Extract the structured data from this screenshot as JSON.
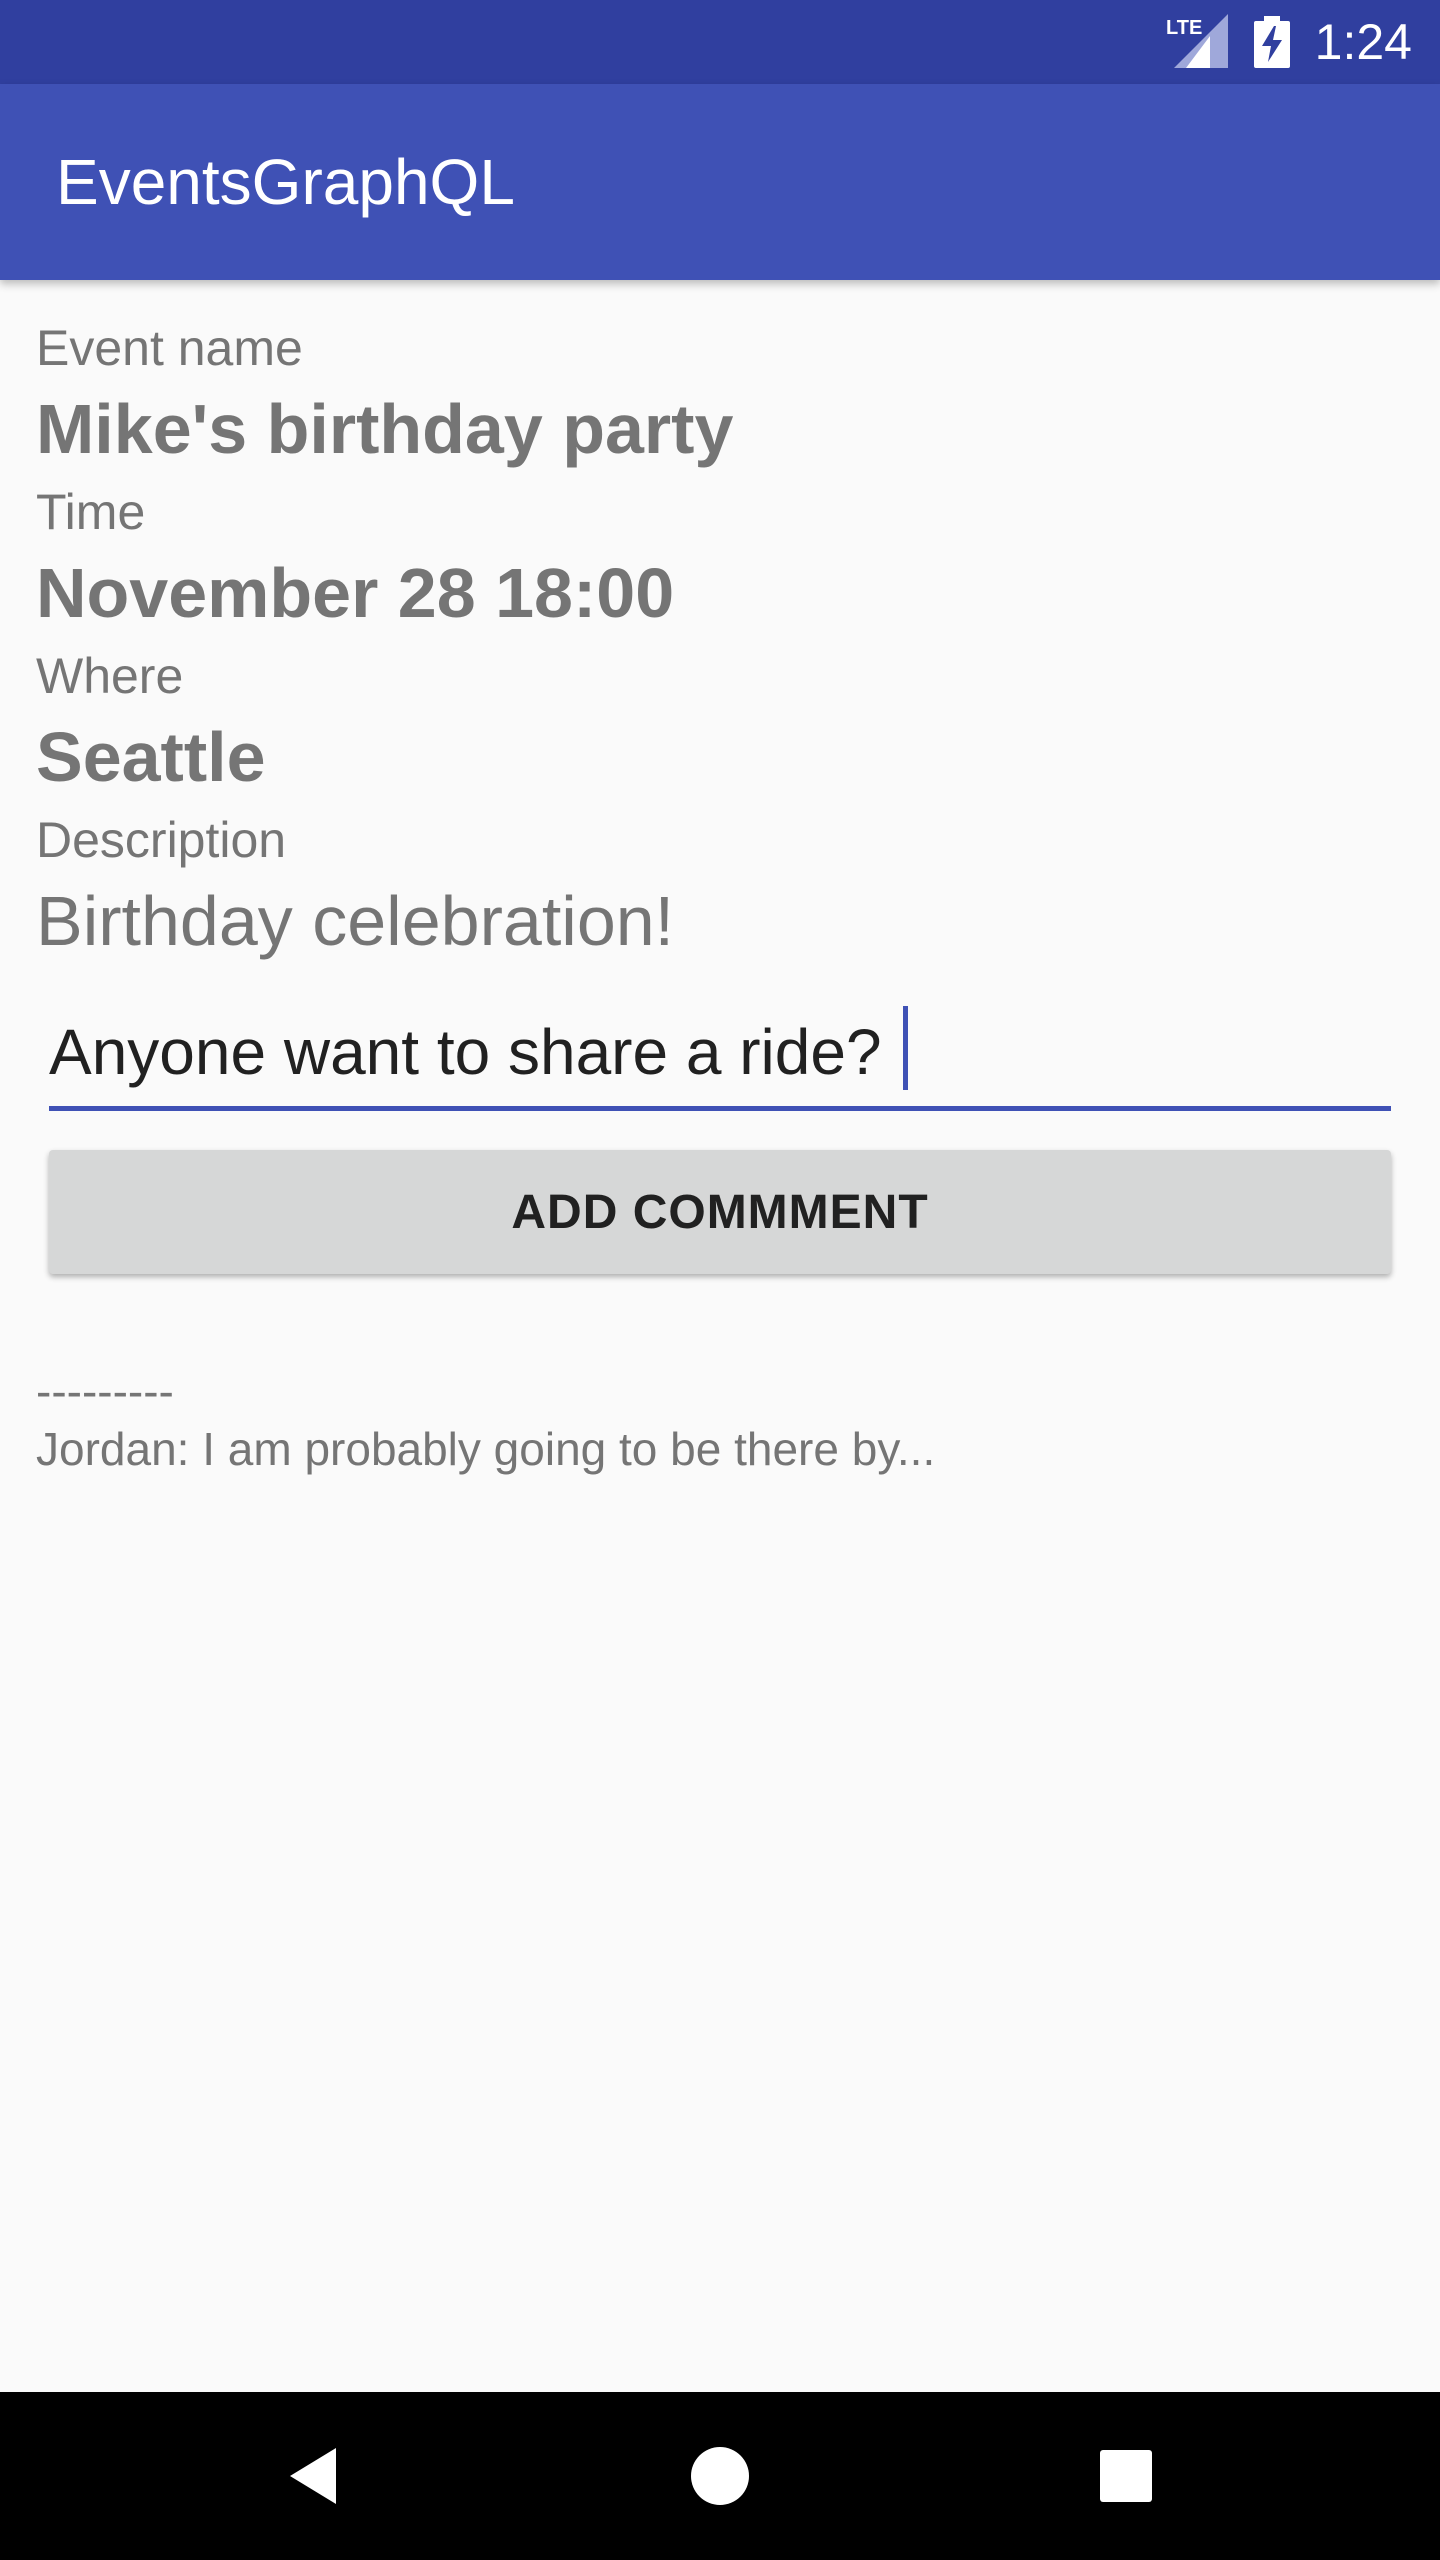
{
  "status_bar": {
    "time": "1:24",
    "network_label": "LTE",
    "network_icon": "lte-signal-icon",
    "battery_icon": "battery-charging-icon",
    "color": "#303f9f"
  },
  "app_bar": {
    "title": "EventsGraphQL",
    "color": "#3f51b5"
  },
  "event": {
    "name_label": "Event name",
    "name_value": "Mike's birthday party",
    "time_label": "Time",
    "time_value": "November 28 18:00",
    "where_label": "Where",
    "where_value": "Seattle",
    "description_label": "Description",
    "description_value": "Birthday celebration!"
  },
  "comment_form": {
    "input_value": "Anyone want to share a ride?",
    "button_label": "ADD COMMMENT"
  },
  "comments": {
    "divider": "---------",
    "items": [
      {
        "text": "Jordan: I am probably going to be there by..."
      }
    ]
  },
  "nav_bar": {
    "back_icon": "back-triangle-icon",
    "home_icon": "home-circle-icon",
    "recents_icon": "recents-square-icon"
  }
}
